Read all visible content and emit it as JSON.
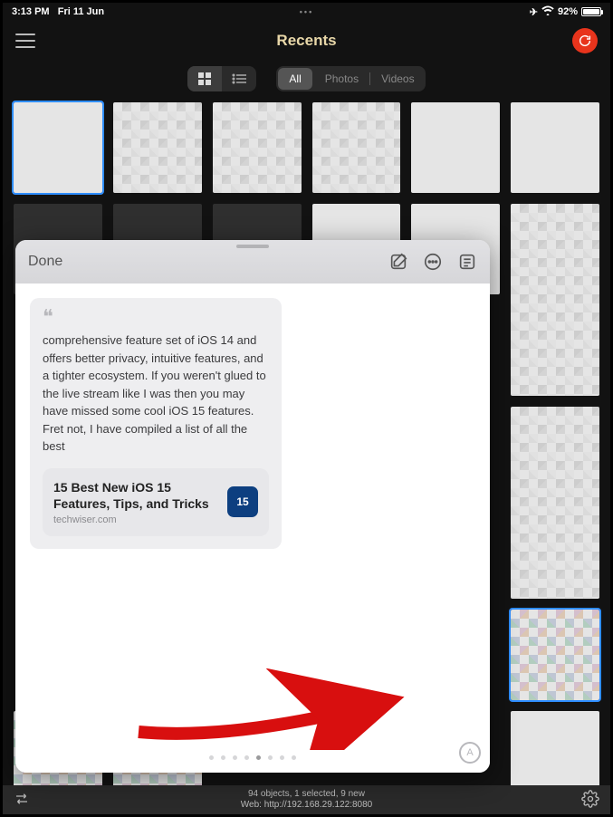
{
  "statusbar": {
    "time": "3:13 PM",
    "date": "Fri 11 Jun",
    "battery_pct": "92%"
  },
  "nav": {
    "title": "Recents"
  },
  "filters": {
    "all": "All",
    "photos": "Photos",
    "videos": "Videos"
  },
  "quicknote": {
    "done": "Done",
    "text": "comprehensive feature set of iOS 14 and offers better privacy, intuitive features, and a tighter ecosystem. If you weren't glued to the live stream like I was then you may have missed some cool iOS 15 features. Fret not, I have compiled a list of all the best",
    "link_title": "15 Best New iOS 15 Features, Tips, and Tricks",
    "link_domain": "techwiser.com",
    "link_badge": "15"
  },
  "bottombar": {
    "line1": "94 objects, 1 selected, 9 new",
    "line2": "Web: http://192.168.29.122:8080"
  }
}
